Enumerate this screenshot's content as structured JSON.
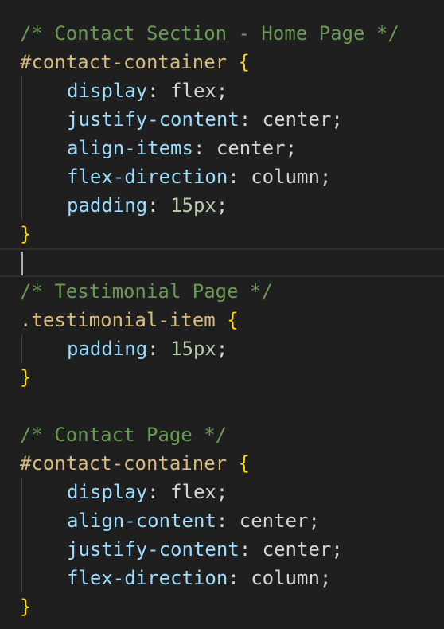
{
  "editor": {
    "theme": {
      "background": "#1f1f1f"
    },
    "lines": [
      {
        "kind": "comment",
        "text": "/* Contact Section - Home Page */"
      },
      {
        "kind": "rule-open",
        "selector": "#contact-container",
        "brace": "{"
      },
      {
        "kind": "decl",
        "prop": "display",
        "value": "flex",
        "value_kind": "keyword"
      },
      {
        "kind": "decl",
        "prop": "justify-content",
        "value": "center",
        "value_kind": "keyword"
      },
      {
        "kind": "decl",
        "prop": "align-items",
        "value": "center",
        "value_kind": "keyword"
      },
      {
        "kind": "decl",
        "prop": "flex-direction",
        "value": "column",
        "value_kind": "keyword"
      },
      {
        "kind": "decl",
        "prop": "padding",
        "value": "15px",
        "value_kind": "number"
      },
      {
        "kind": "rule-close",
        "brace": "}"
      },
      {
        "kind": "current-empty"
      },
      {
        "kind": "comment",
        "text": "/* Testimonial Page */"
      },
      {
        "kind": "rule-open",
        "selector": ".testimonial-item",
        "brace": "{"
      },
      {
        "kind": "decl",
        "prop": "padding",
        "value": "15px",
        "value_kind": "number"
      },
      {
        "kind": "rule-close",
        "brace": "}"
      },
      {
        "kind": "empty"
      },
      {
        "kind": "comment",
        "text": "/* Contact Page */"
      },
      {
        "kind": "rule-open",
        "selector": "#contact-container",
        "brace": "{"
      },
      {
        "kind": "decl",
        "prop": "display",
        "value": "flex",
        "value_kind": "keyword"
      },
      {
        "kind": "decl",
        "prop": "align-content",
        "value": "center",
        "value_kind": "keyword"
      },
      {
        "kind": "decl",
        "prop": "justify-content",
        "value": "center",
        "value_kind": "keyword"
      },
      {
        "kind": "decl",
        "prop": "flex-direction",
        "value": "column",
        "value_kind": "keyword"
      },
      {
        "kind": "rule-close",
        "brace": "}"
      }
    ]
  }
}
